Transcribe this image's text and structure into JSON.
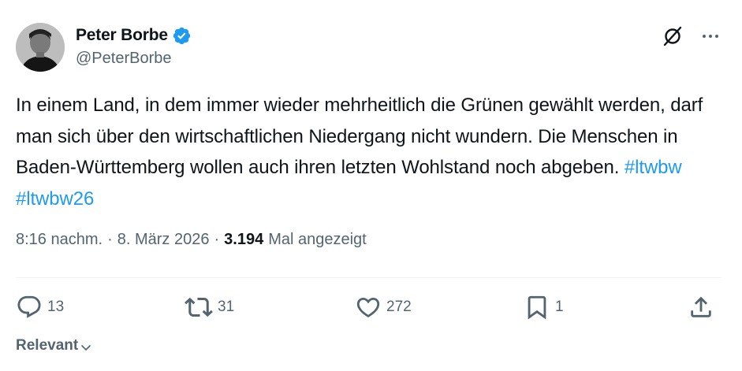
{
  "author": {
    "display_name": "Peter Borbe",
    "handle": "@PeterBorbe",
    "verified": true
  },
  "tweet": {
    "text_segments": [
      "In einem Land, in dem immer wieder mehrheitlich die Grünen gewählt werden, darf man sich über den wirtschaftlichen Niedergang nicht wundern. Die Menschen in Baden-Württemberg wollen auch ihren letzten Wohlstand noch abgeben. "
    ],
    "hashtags": [
      "#ltwbw",
      "#ltwbw26"
    ]
  },
  "meta": {
    "time": "8:16 nachm.",
    "separator": "·",
    "date": "8. März 2026",
    "views_count": "3.194",
    "views_label": "Mal angezeigt"
  },
  "actions": {
    "replies": "13",
    "reposts": "31",
    "likes": "272",
    "bookmarks": "1"
  },
  "sort": {
    "label": "Relevant"
  },
  "colors": {
    "text": "#0f1419",
    "secondary": "#536471",
    "accent": "#1d9bf0",
    "divider": "#eff3f4"
  },
  "icons": [
    "verified-badge-icon",
    "grok-icon",
    "more-icon",
    "reply-icon",
    "repost-icon",
    "like-icon",
    "bookmark-icon",
    "share-icon",
    "chevron-down-icon"
  ]
}
